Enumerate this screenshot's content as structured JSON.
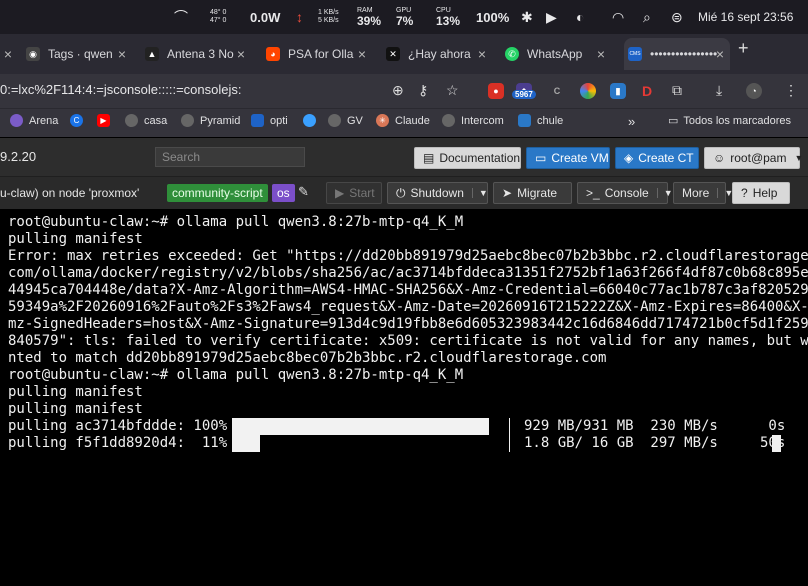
{
  "menubar": {
    "temp_top": "48°",
    "temp_top_val": "0",
    "temp_bottom": "47°",
    "temp_bottom_val": "0",
    "power": "0.0W",
    "net_up": "1 KB/s",
    "net_down": "5 KB/s",
    "ram_label": "RAM",
    "ram_val": "39%",
    "gpu_label": "GPU",
    "gpu_val": "7%",
    "cpu_label": "CPU",
    "cpu_val": "13%",
    "battery": "100%",
    "datetime": "Mié 16 sept  23:56"
  },
  "tabs": [
    {
      "title": "Tags · qwen",
      "color": "#444"
    },
    {
      "title": "Antena 3 No",
      "color": "#222"
    },
    {
      "title": "PSA for Olla",
      "color": "#ff4500"
    },
    {
      "title": "¿Hay ahora",
      "color": "#111"
    },
    {
      "title": "WhatsApp",
      "color": "#25d366"
    },
    {
      "title": "••••••••••••••••",
      "color": "#1e63c7"
    }
  ],
  "fav_glyphs": [
    "◉",
    "▲",
    "◕",
    "✕",
    "✆",
    "CMS"
  ],
  "newtab": "+",
  "address": {
    "url": "0:=lxc%2F114:4:=jsconsole:::::=consolejs:",
    "badge": "5967"
  },
  "bookmarks": [
    {
      "label": "Arena",
      "color": "#7b5cc8"
    },
    {
      "label": "",
      "color": "#1a73e8"
    },
    {
      "label": "",
      "color": "#ff0000"
    },
    {
      "label": "casa",
      "color": "#666"
    },
    {
      "label": "Pyramid",
      "color": "#666"
    },
    {
      "label": "opti",
      "color": "#1e63c7"
    },
    {
      "label": "",
      "color": "#3aa0ff"
    },
    {
      "label": "GV",
      "color": "#666"
    },
    {
      "label": "Claude",
      "color": "#d97757"
    },
    {
      "label": "Intercom",
      "color": "#666"
    },
    {
      "label": "chule",
      "color": "#2a78c7"
    }
  ],
  "bookmarks_more": "»",
  "bookmarks_all": "Todos los marcadores",
  "pve": {
    "version": "9.2.20",
    "search_placeholder": "Search",
    "documentation": "Documentation",
    "create_vm": "Create VM",
    "create_ct": "Create CT",
    "user": "root@pam",
    "node_info": "u-claw) on node 'proxmox'",
    "tag_community": "community-script",
    "tag_os": "os",
    "start": "Start",
    "shutdown": "Shutdown",
    "migrate": "Migrate",
    "console": "Console",
    "more": "More",
    "help": "Help"
  },
  "terminal": {
    "lines": [
      "root@ubuntu-claw:~# ollama pull qwen3.8:27b-mtp-q4_K_M",
      "pulling manifest",
      "Error: max retries exceeded: Get \"https://dd20bb891979d25aebc8bec07b2b3bbc.r2.cloudflarestorage.",
      "com/ollama/docker/registry/v2/blobs/sha256/ac/ac3714bfddeca31351f2752bf1a63f266f4df87c0b68c895e",
      "44945ca704448e/data?X-Amz-Algorithm=AWS4-HMAC-SHA256&X-Amz-Credential=66040c77ac1b787c3af8205298",
      "59349a%2F20260916%2Fauto%2Fs3%2Faws4_request&X-Amz-Date=20260916T215222Z&X-Amz-Expires=86400&X-A",
      "mz-SignedHeaders=host&X-Amz-Signature=913d4c9d19fbb8e6d605323983442c16d6846dd7174721b0cf5d1f259e",
      "840579\": tls: failed to verify certificate: x509: certificate is not valid for any names, but wa",
      "nted to match dd20bb891979d25aebc8bec07b2b3bbc.r2.cloudflarestorage.com",
      "root@ubuntu-claw:~# ollama pull qwen3.8:27b-mtp-q4_K_M",
      "pulling manifest",
      "pulling manifest"
    ],
    "progress": [
      {
        "label": "pulling ac3714bfddde: 100%",
        "fraction": 1.0,
        "stats": "929 MB/931 MB  230 MB/s      0s"
      },
      {
        "label": "pulling f5f1dd8920d4:  11%",
        "fraction": 0.11,
        "stats": "1.8 GB/ 16 GB  297 MB/s     50s"
      }
    ]
  }
}
